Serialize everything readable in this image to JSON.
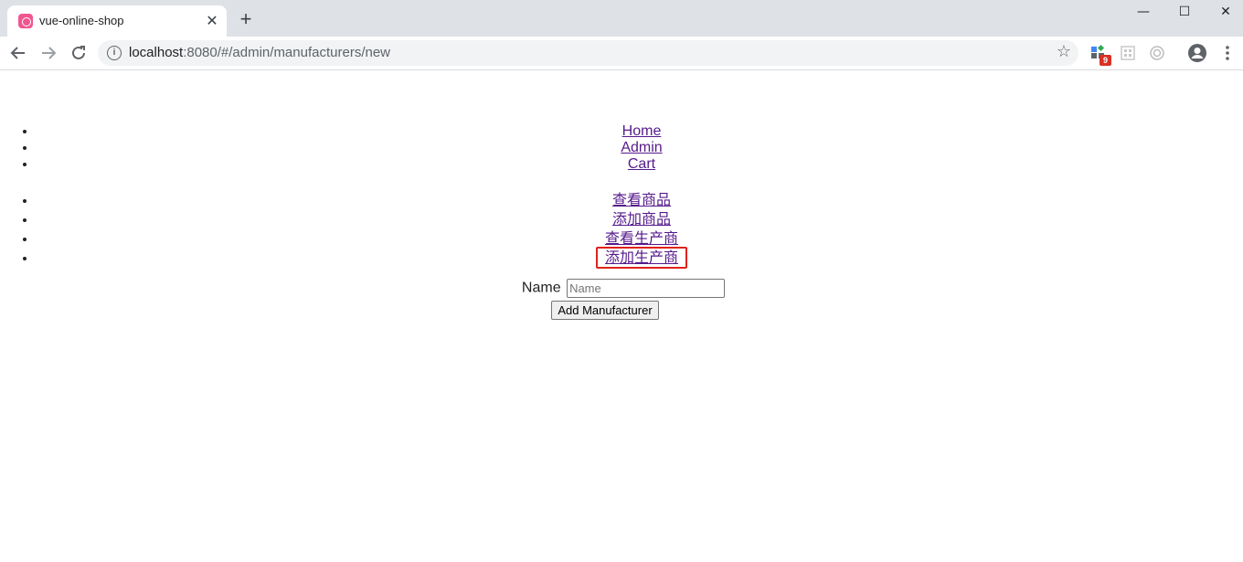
{
  "browser": {
    "tab_title": "vue-online-shop",
    "url_host": "localhost",
    "url_path": ":8080/#/admin/manufacturers/new",
    "extension_badge": "9",
    "window_controls": {
      "minimize": "—",
      "maximize": "☐",
      "close": "✕"
    },
    "icons": [
      "back-arrow-icon",
      "forward-arrow-icon",
      "reload-icon",
      "info-icon",
      "star-icon",
      "extension-icon",
      "profile-icon",
      "menu-dots-icon"
    ]
  },
  "nav": {
    "items": [
      "Home",
      "Admin",
      "Cart"
    ]
  },
  "admin_nav": {
    "items": [
      "查看商品",
      "添加商品",
      "查看生产商",
      "添加生产商"
    ],
    "highlighted_index": 3
  },
  "form": {
    "name_label": "Name",
    "name_placeholder": "Name",
    "name_value": "",
    "submit_label": "Add Manufacturer"
  },
  "colors": {
    "link": "#551a8b",
    "highlight_border": "#e0221b",
    "tabstrip": "#dee1e6"
  }
}
